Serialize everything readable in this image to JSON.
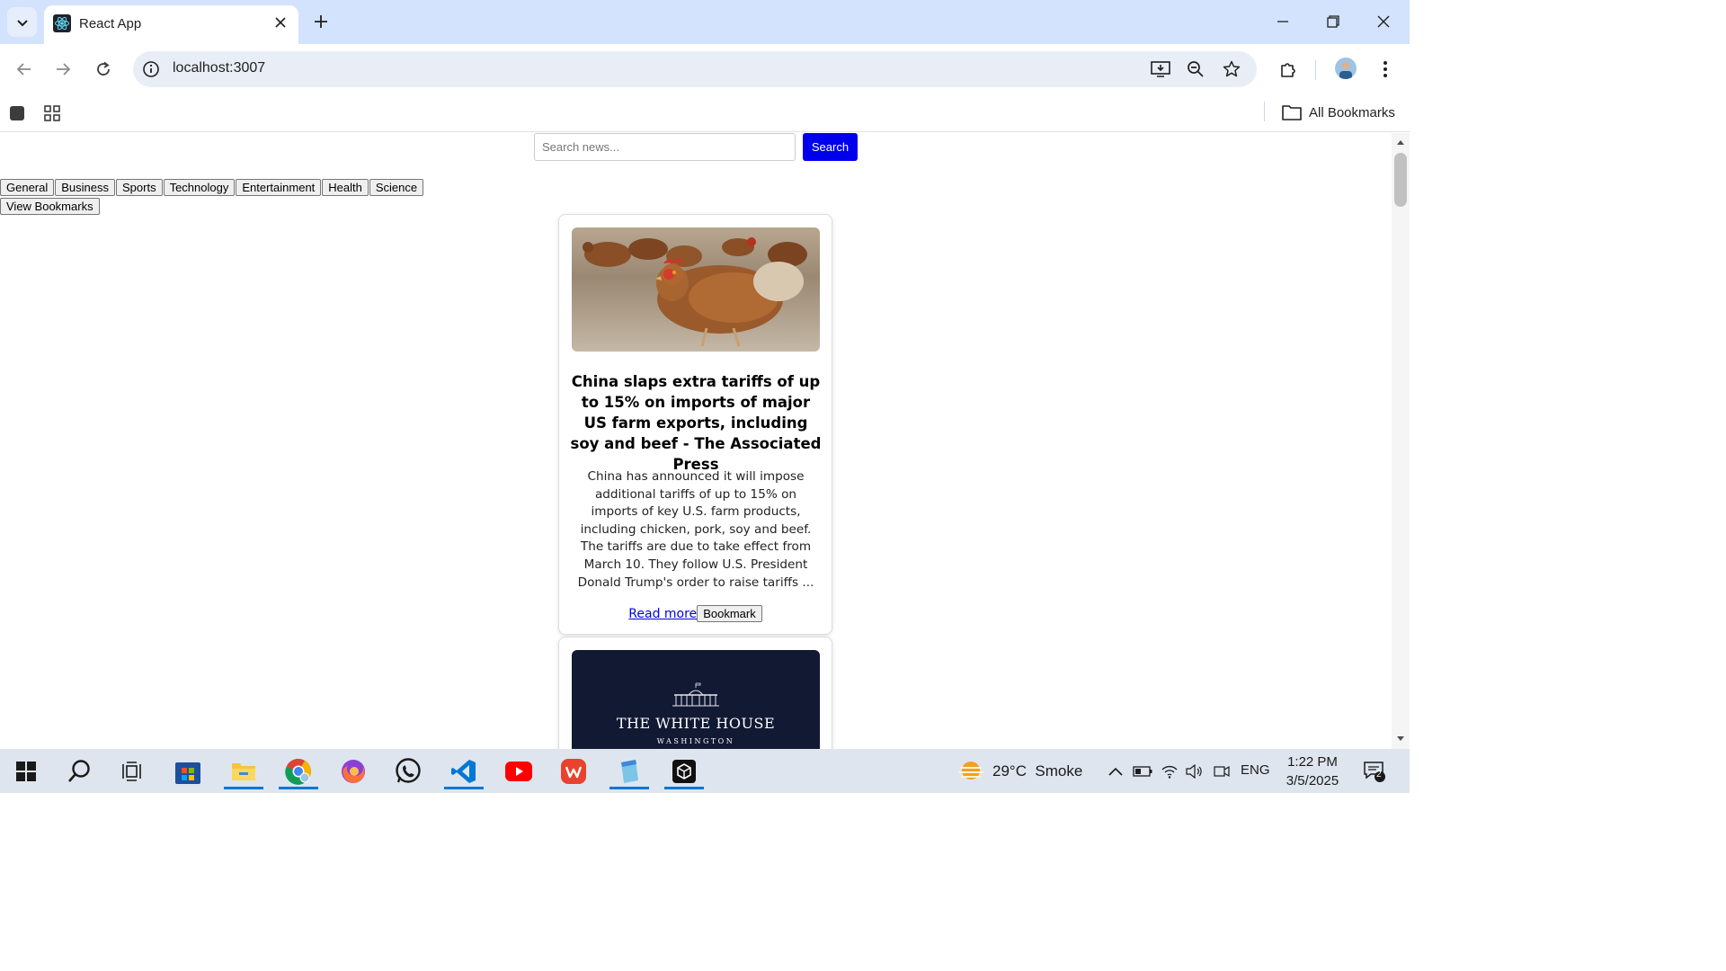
{
  "browser": {
    "tab_title": "React App",
    "url": "localhost:3007",
    "all_bookmarks_label": "All Bookmarks"
  },
  "page": {
    "search": {
      "placeholder": "Search news...",
      "button_label": "Search"
    },
    "categories": [
      "General",
      "Business",
      "Sports",
      "Technology",
      "Entertainment",
      "Health",
      "Science"
    ],
    "view_bookmarks_label": "View Bookmarks",
    "articles": [
      {
        "image_icon": "chickens-photo",
        "title": "China slaps extra tariffs of up to 15% on imports of major US farm exports, including soy and beef - The Associated Press",
        "description": "China has announced it will impose additional tariffs of up to 15% on imports of key U.S. farm products, including chicken, pork, soy and beef. The tariffs are due to take effect from March 10. They follow U.S. President Donald Trump's order to raise tariffs ...",
        "read_more_label": "Read more",
        "bookmark_label": "Bookmark"
      },
      {
        "image_icon": "white-house-logo",
        "image_text_main": "THE WHITE HOUSE",
        "image_text_sub": "WASHINGTON"
      }
    ]
  },
  "taskbar": {
    "weather": "29°C  Smoke",
    "language": "ENG",
    "time": "1:22 PM",
    "date": "3/5/2025",
    "notification_count": "2"
  },
  "colors": {
    "search_button": "#0000ee",
    "link": "#0000ee",
    "tabstrip": "#d3e3fd"
  }
}
